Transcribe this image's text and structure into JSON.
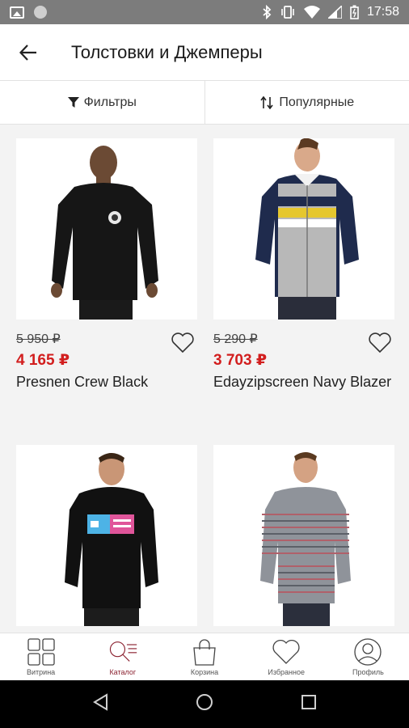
{
  "status_bar": {
    "time": "17:58"
  },
  "app_bar": {
    "title": "Толстовки и Джемперы"
  },
  "filters": {
    "filter_label": "Фильтры",
    "sort_label": "Популярные"
  },
  "products": [
    {
      "old_price": "5 950 ₽",
      "new_price": "4 165 ₽",
      "name": "Presnen Crew Black"
    },
    {
      "old_price": "5 290 ₽",
      "new_price": "3 703 ₽",
      "name": "Edayzipscreen Navy Blazer"
    },
    {
      "old_price": "",
      "new_price": "",
      "name": ""
    },
    {
      "old_price": "",
      "new_price": "",
      "name": ""
    }
  ],
  "bottom_nav": [
    {
      "label": "Витрина",
      "icon": "grid-icon"
    },
    {
      "label": "Каталог",
      "icon": "catalog-search-icon",
      "active": true
    },
    {
      "label": "Корзина",
      "icon": "shopping-bag-icon"
    },
    {
      "label": "Избранное",
      "icon": "heart-icon"
    },
    {
      "label": "Профиль",
      "icon": "profile-icon"
    }
  ],
  "colors": {
    "accent": "#8b2230",
    "sale_price": "#d21e1e",
    "status_bar": "#7c7c7c"
  }
}
